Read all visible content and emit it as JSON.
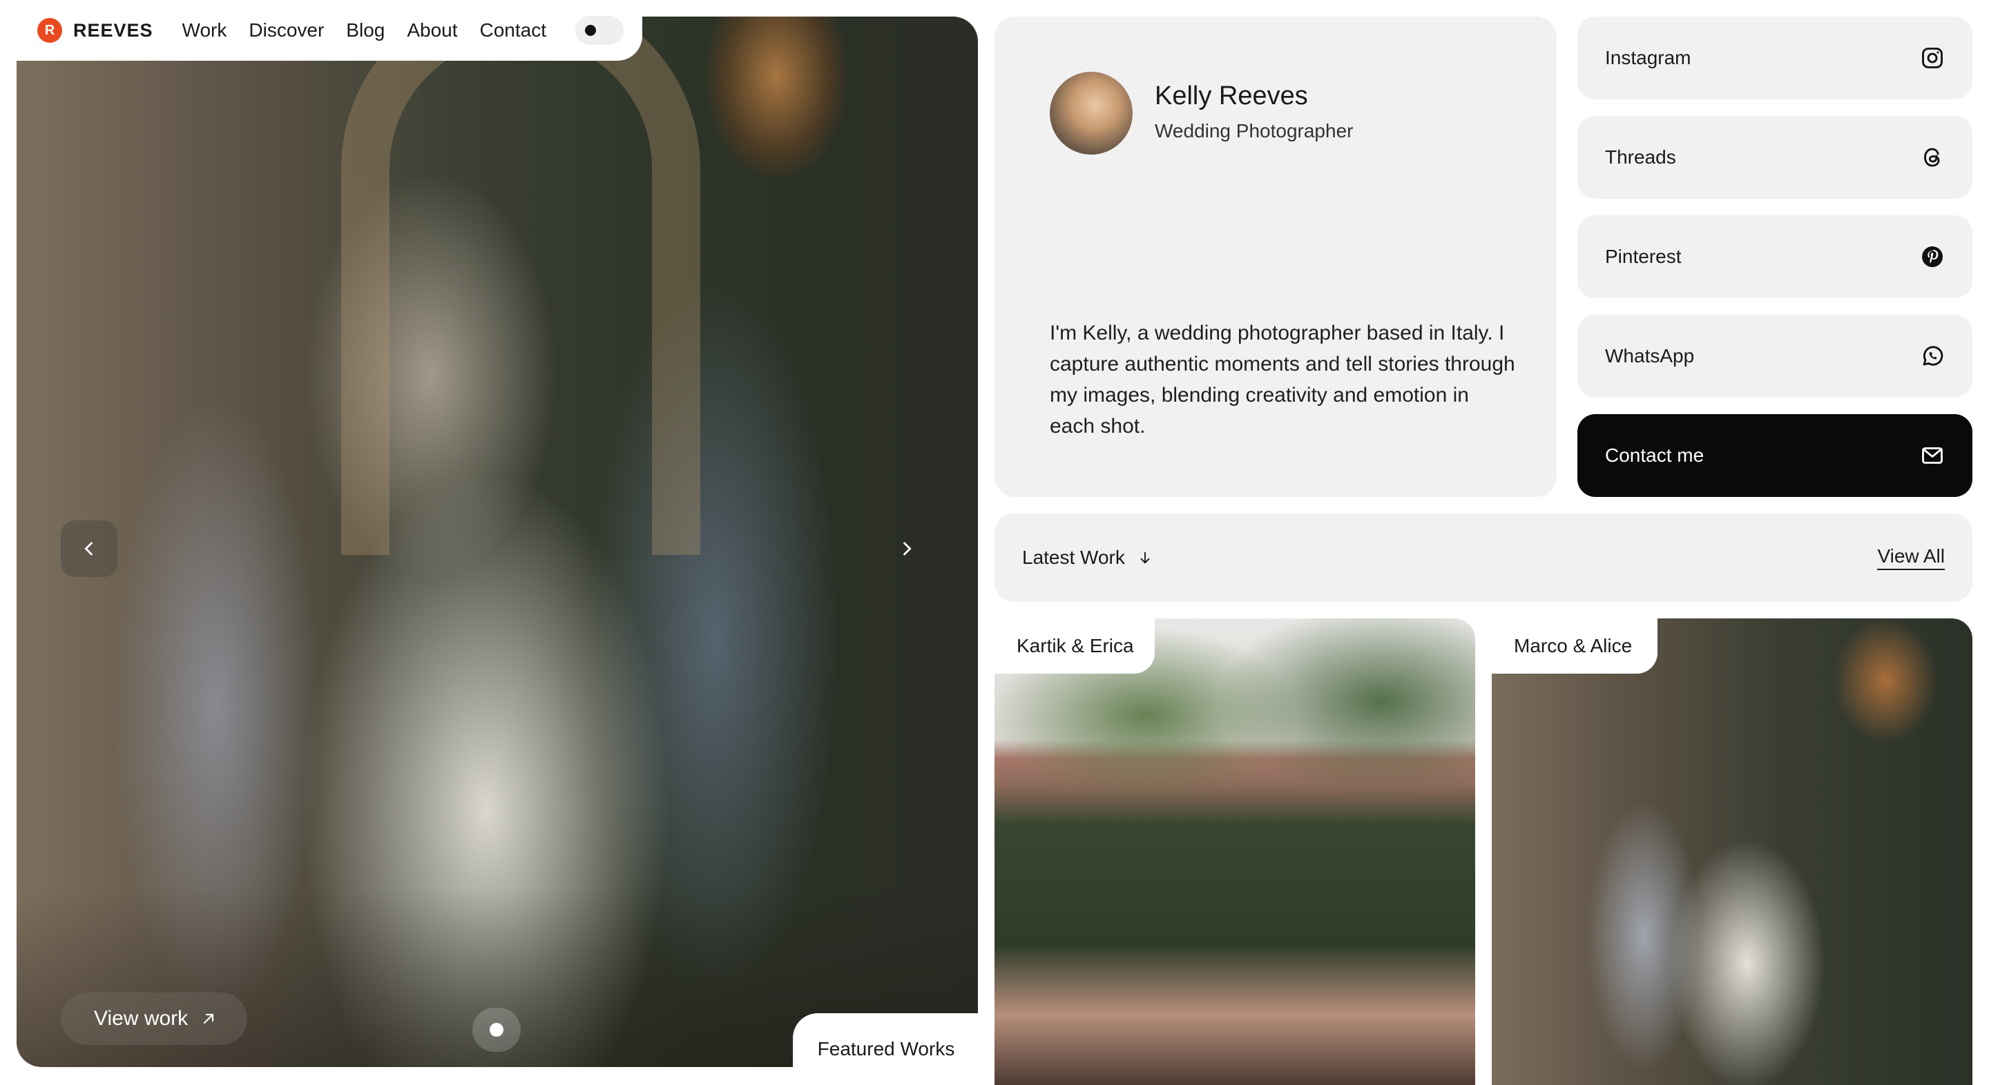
{
  "brand": {
    "logo_letter": "R",
    "name": "REEVES",
    "accent": "#ea4a1f"
  },
  "nav": {
    "links": [
      "Work",
      "Discover",
      "Blog",
      "About",
      "Contact"
    ]
  },
  "hero": {
    "view_work_label": "View work",
    "featured_label": "Featured Works",
    "icons": {
      "prev": "chevron-left-icon",
      "next": "chevron-right-icon",
      "external": "arrow-up-right-icon"
    }
  },
  "profile": {
    "name": "Kelly Reeves",
    "role": "Wedding Photographer",
    "bio": "I'm Kelly, a wedding photographer based in Italy. I capture authentic moments and tell stories through my images, blending creativity and emotion in each shot."
  },
  "social": [
    {
      "label": "Instagram",
      "icon": "instagram-icon"
    },
    {
      "label": "Threads",
      "icon": "threads-icon"
    },
    {
      "label": "Pinterest",
      "icon": "pinterest-icon"
    },
    {
      "label": "WhatsApp",
      "icon": "whatsapp-icon"
    },
    {
      "label": "Contact me",
      "icon": "mail-icon"
    }
  ],
  "latest": {
    "label": "Latest Work",
    "view_all": "View All"
  },
  "works": [
    {
      "title": "Kartik & Erica"
    },
    {
      "title": "Marco & Alice"
    }
  ]
}
